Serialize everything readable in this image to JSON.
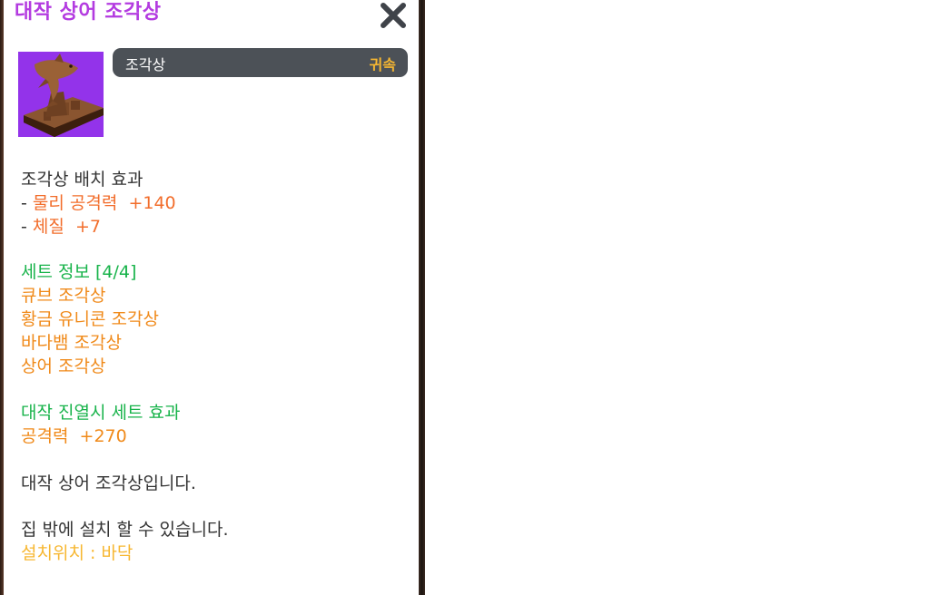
{
  "item": {
    "title": "대작 상어 조각상",
    "type_label": "조각상",
    "bind_label": "귀속",
    "icon_color": "#9333ea"
  },
  "placement_effect": {
    "heading": "조각상 배치 효과",
    "stats": [
      {
        "prefix": "- ",
        "name": "물리 공격력",
        "value": "+140"
      },
      {
        "prefix": "- ",
        "name": "체질",
        "value": "+7"
      }
    ]
  },
  "set_info": {
    "heading": "세트 정보 [4/4]",
    "members": [
      "큐브 조각상",
      "황금 유니콘 조각상",
      "바다뱀 조각상",
      "상어 조각상"
    ]
  },
  "set_effect": {
    "heading": "대작 진열시 세트 효과",
    "stat_name": "공격력",
    "stat_value": "+270"
  },
  "description": {
    "line1": "대작 상어 조각상입니다.",
    "line2": "집 밖에 설치 할 수 있습니다.",
    "location": "설치위치 : 바닥"
  },
  "colors": {
    "title": "#b33be0",
    "stat": "#f26d2b",
    "set_member": "#f08a1a",
    "set_heading": "#17b34a",
    "location": "#f7b731"
  }
}
